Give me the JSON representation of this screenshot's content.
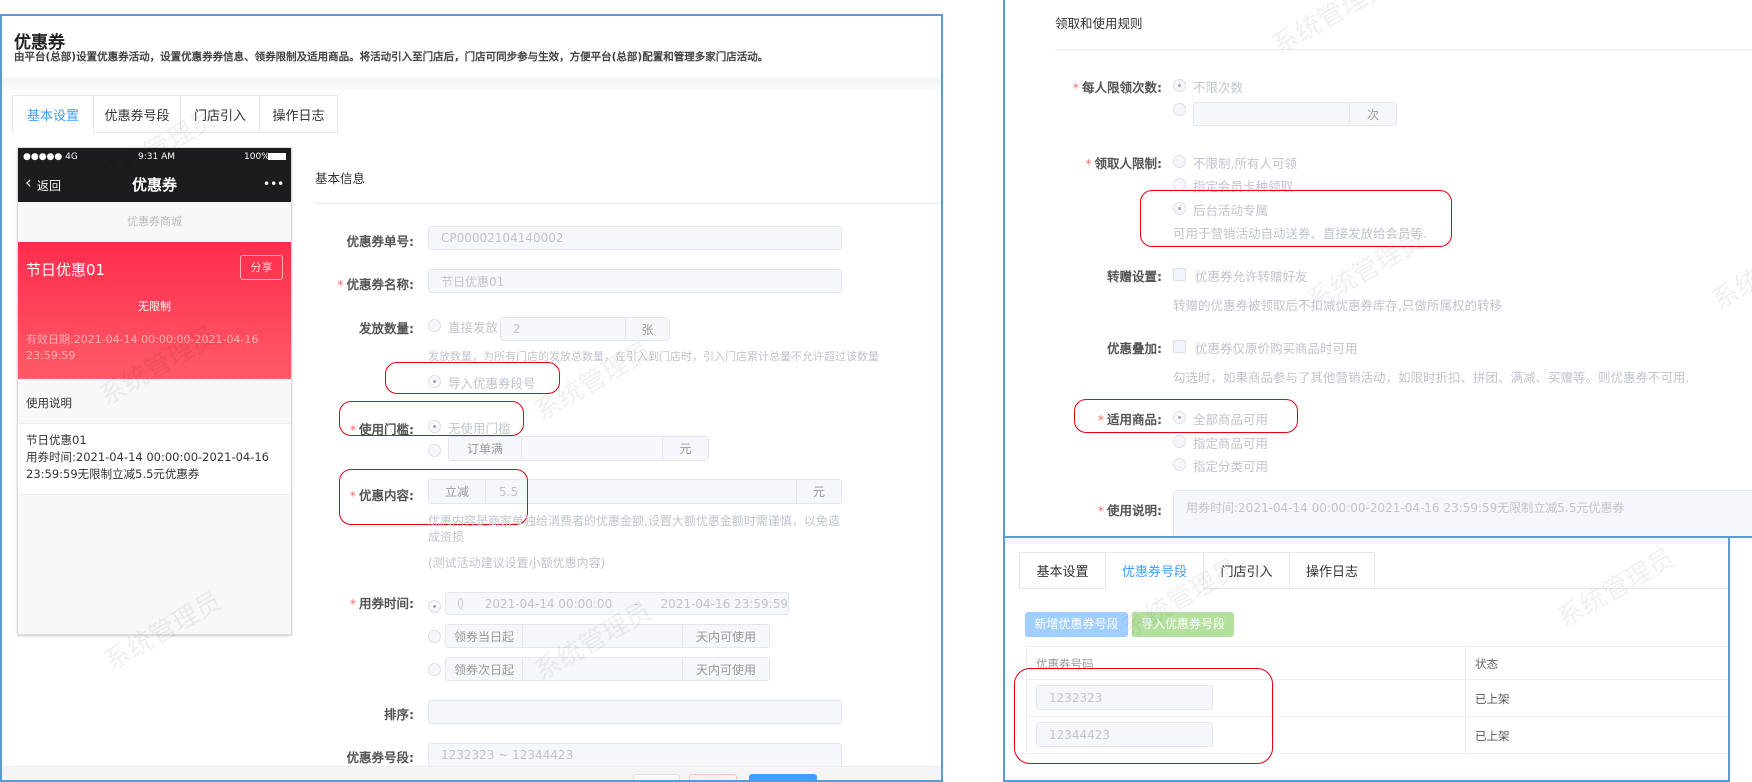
{
  "watermark": "系统管理员",
  "colors": {
    "border": "#5b9bd5",
    "accent": "#409eff",
    "coupon": "#ff3350",
    "highlight": "#e60012"
  },
  "page": {
    "title": "优惠券",
    "description": "由平台(总部)设置优惠券活动，设置优惠券券信息、领券限制及适用商品。将活动引入至门店后，门店可同步参与生效，方便平台(总部)配置和管理多家门店活动。",
    "tabs": [
      "基本设置",
      "优惠券号段",
      "门店引入",
      "操作日志"
    ],
    "active_tab": "基本设置"
  },
  "phone": {
    "signal": "●●●●● 4G",
    "time": "9:31 AM",
    "battery": "100%",
    "back": "返回",
    "title": "优惠券",
    "more": "•••",
    "mall": "优惠券商城",
    "coupon_name": "节日优惠01",
    "share": "分享",
    "limit": "无限制",
    "validity": "有效日期:2021-04-14 00:00:00-2021-04-16 23:59:59",
    "usage_title": "使用说明",
    "usage_name": "节日优惠01",
    "usage_text": "用券时间:2021-04-14 00:00:00-2021-04-16 23:59:59无限制立减5.5元优惠券"
  },
  "basic": {
    "section": "基本信息",
    "code_label": "优惠券单号:",
    "code_value": "CP00002104140002",
    "name_label": "优惠券名称:",
    "name_value": "节日优惠01",
    "qty_label": "发放数量:",
    "qty_opt_direct": "直接发放",
    "qty_value": "2",
    "qty_unit": "张",
    "qty_hint": "发放数量，为所有门店的发放总数量，在引入到门店时，引入门店累计总量不允许超过该数量",
    "qty_opt_import": "导入优惠券段号",
    "threshold_label": "使用门槛:",
    "threshold_none": "无使用门槛",
    "threshold_prefix": "订单满",
    "threshold_unit": "元",
    "discount_label": "优惠内容:",
    "discount_prefix": "立减",
    "discount_value": "5.5",
    "discount_unit": "元",
    "discount_hint1": "优惠内容是商家单独给消费者的优惠金额,设置大额优惠金额时需谨慎，以免造",
    "discount_hint2": "成资损",
    "discount_hint3": "(测试活动建议设置小额优惠内容)",
    "time_label": "用券时间:",
    "time_start": "2021-04-14 00:00:00",
    "time_sep": "-",
    "time_end": "2021-04-16 23:59:59",
    "time_same_day": "领券当日起",
    "time_next_day": "领券次日起",
    "time_unit": "天内可使用",
    "sort_label": "排序:",
    "segment_label": "优惠券号段:",
    "segment_value": "1232323 ~ 12344423"
  },
  "rules": {
    "section": "领取和使用规则",
    "per_person_label": "每人限领次数:",
    "per_person_unlimited": "不限次数",
    "per_person_unit": "次",
    "receiver_label": "领取人限制:",
    "receiver_opts": [
      "不限制,所有人可领",
      "指定会员卡种领取",
      "后台活动专属"
    ],
    "receiver_hint": "可用于营销活动自动送券、直接发放给会员等.",
    "transfer_label": "转赠设置:",
    "transfer_opt": "优惠券允许转赠好友",
    "transfer_hint": "转赠的优惠券被领取后不扣减优惠券库存,只做所属权的转移",
    "stack_label": "优惠叠加:",
    "stack_opt": "优惠券仅原价购买商品时可用",
    "stack_hint": "勾选时，如果商品参与了其他营销活动，如限时折扣、拼团、满减、买赠等。则优惠券不可用.",
    "goods_label": "适用商品:",
    "goods_opts": [
      "全部商品可用",
      "指定商品可用",
      "指定分类可用"
    ],
    "desc_label": "使用说明:",
    "desc_value": "用券时间:2021-04-14 00:00:00-2021-04-16 23:59:59无限制立减5.5元优惠券"
  },
  "segments": {
    "tabs": [
      "基本设置",
      "优惠券号段",
      "门店引入",
      "操作日志"
    ],
    "active_tab": "优惠券号段",
    "add_button": "新增优惠券号段",
    "import_button": "导入优惠券号段",
    "columns": [
      "优惠券号码",
      "状态"
    ],
    "rows": [
      {
        "code": "1232323",
        "status": "已上架"
      },
      {
        "code": "12344423",
        "status": "已上架"
      }
    ]
  }
}
